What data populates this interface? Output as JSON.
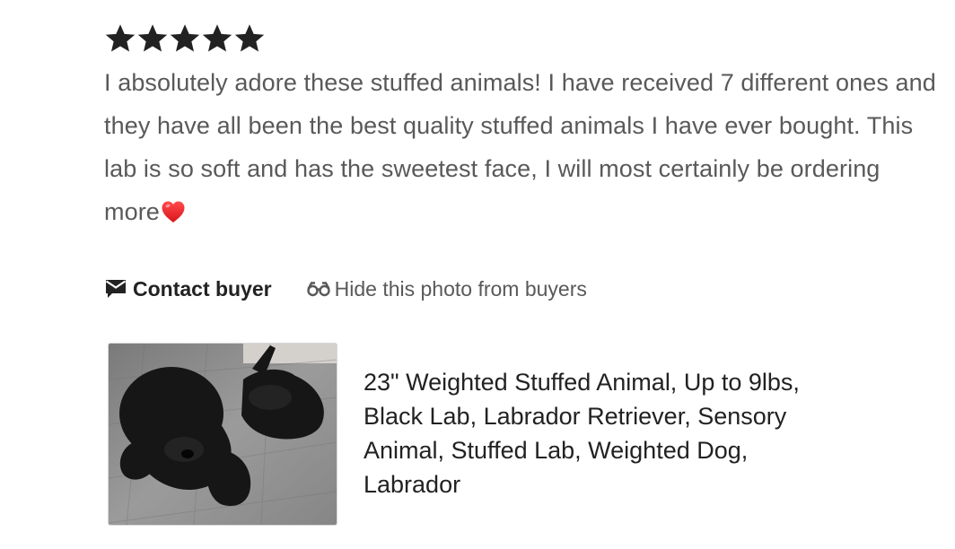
{
  "review": {
    "rating": 5,
    "rating_max": 5,
    "star_icon": "star-icon",
    "star_color": "#222222",
    "text": "I absolutely adore these stuffed animals! I have received 7 different ones and they have all been the best quality stuffed animals I have ever bought. This lab is so soft and has the sweetest face, I will most certainly be ordering more",
    "emoji_icon": "red-heart-icon"
  },
  "actions": {
    "contact_buyer_label": "Contact buyer",
    "contact_icon": "message-icon",
    "hide_photo_label": "Hide this photo from buyers",
    "hide_icon": "glasses-icon"
  },
  "product": {
    "title": "23\" Weighted Stuffed Animal, Up to 9lbs, Black Lab, Labrador Retriever, Sensory Animal, Stuffed Lab, Weighted Dog, Labrador",
    "photo_icon": "product-photo"
  }
}
